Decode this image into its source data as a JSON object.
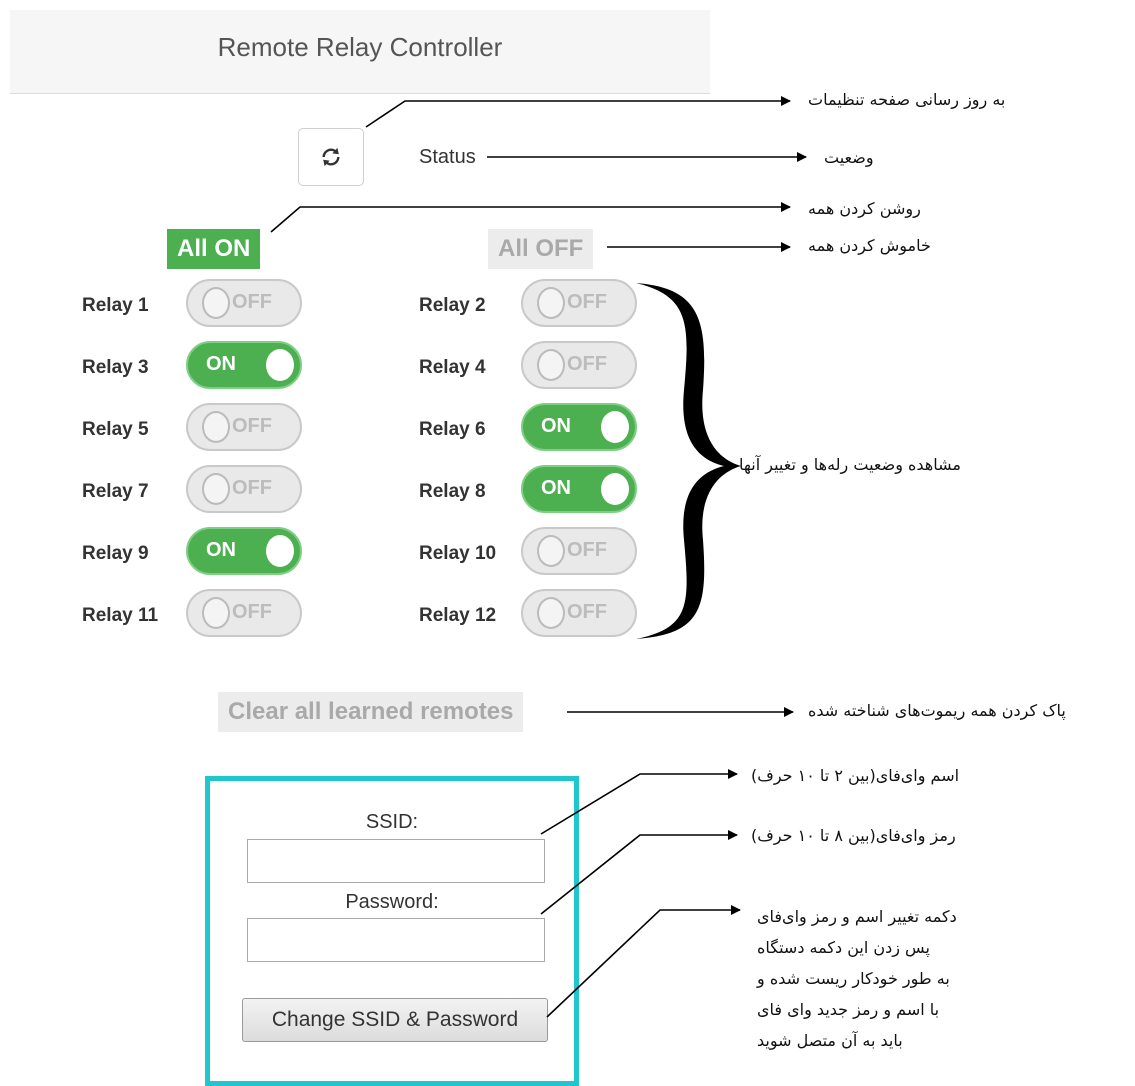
{
  "header": {
    "title": "Remote Relay Controller"
  },
  "status": {
    "label": "Status"
  },
  "controls": {
    "all_on": "All ON",
    "all_off": "All OFF",
    "clear_remotes": "Clear all learned remotes"
  },
  "relays": [
    {
      "label": "Relay 1",
      "state": "OFF"
    },
    {
      "label": "Relay 2",
      "state": "OFF"
    },
    {
      "label": "Relay 3",
      "state": "ON"
    },
    {
      "label": "Relay 4",
      "state": "OFF"
    },
    {
      "label": "Relay 5",
      "state": "OFF"
    },
    {
      "label": "Relay 6",
      "state": "ON"
    },
    {
      "label": "Relay 7",
      "state": "OFF"
    },
    {
      "label": "Relay 8",
      "state": "ON"
    },
    {
      "label": "Relay 9",
      "state": "ON"
    },
    {
      "label": "Relay 10",
      "state": "OFF"
    },
    {
      "label": "Relay 11",
      "state": "OFF"
    },
    {
      "label": "Relay 12",
      "state": "OFF"
    }
  ],
  "wifi": {
    "ssid_label": "SSID:",
    "ssid_value": "",
    "password_label": "Password:",
    "password_value": "",
    "change_button": "Change SSID & Password"
  },
  "annotations": {
    "refresh": "به روز رسانی صفحه تنظیمات",
    "status": "وضعیت",
    "all_on": "روشن کردن همه",
    "all_off": "خاموش کردن همه",
    "relays": "مشاهده وضعیت رله‌ها و تغییر آنها",
    "clear": "پاک کردن همه ریموت‌های شناخته شده",
    "ssid": "اسم وای‌فای(بین ۲ تا ۱۰ حرف)",
    "password": "رمز وای‌فای(بین ۸ تا ۱۰ حرف)",
    "change": [
      "دکمه تغییر اسم و رمز وای‌فای",
      "پس زدن این دکمه دستگاه",
      "به طور خودکار ریست شده و",
      "با اسم و رمز جدید وای فای",
      "باید به آن متصل شوید"
    ]
  },
  "colors": {
    "on": "#4caf50",
    "off_bg": "#e9e9e9",
    "panel_border": "#1ec7cc"
  },
  "icons": {
    "refresh": "refresh-icon"
  }
}
